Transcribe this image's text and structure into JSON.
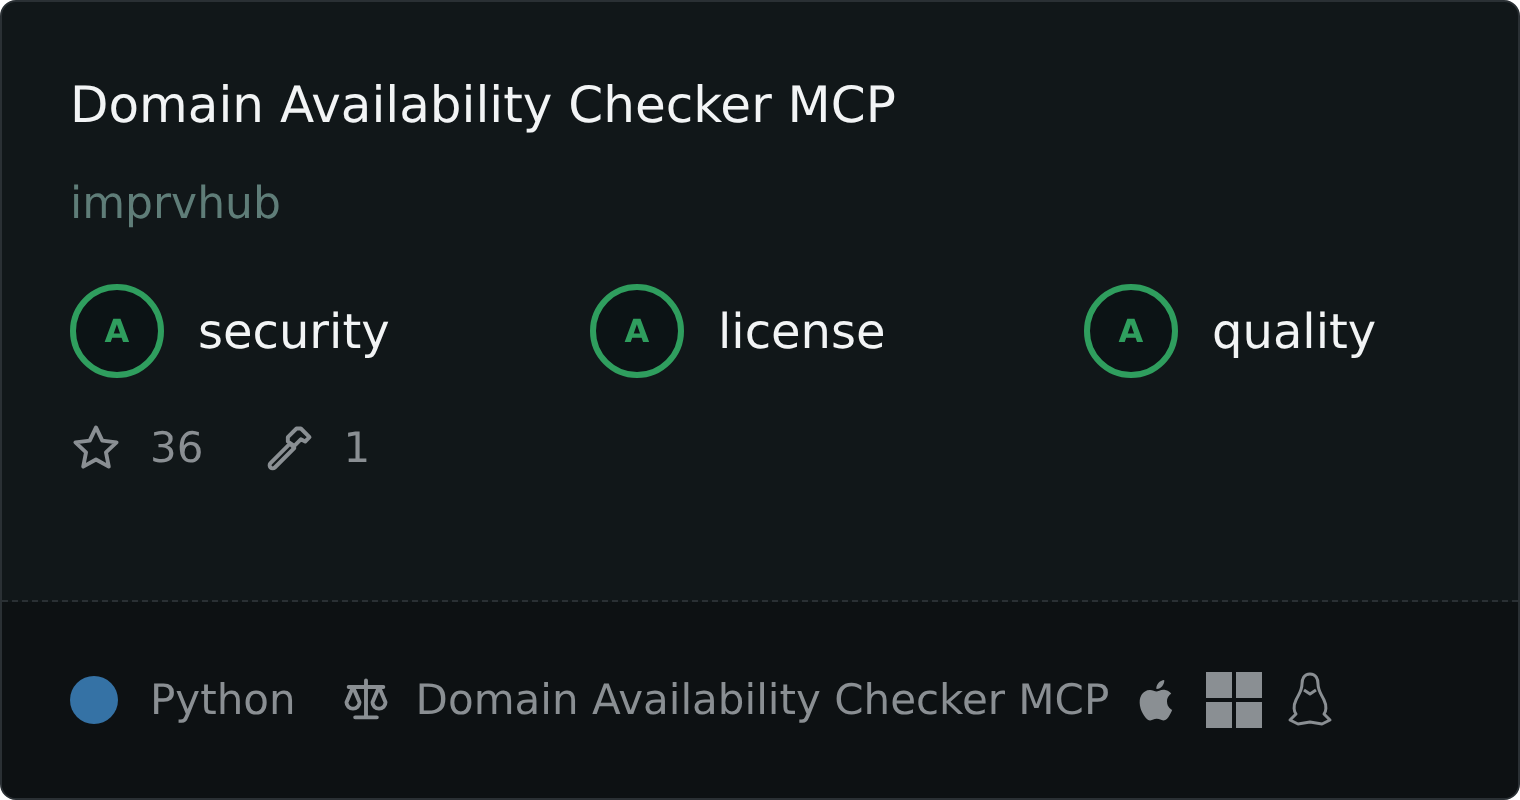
{
  "title": "Domain Availability Checker MCP",
  "author": "imprvhub",
  "scores": [
    {
      "grade": "A",
      "label": "security"
    },
    {
      "grade": "A",
      "label": "license"
    },
    {
      "grade": "A",
      "label": "quality"
    }
  ],
  "stats": {
    "stars": "36",
    "tools": "1"
  },
  "footer": {
    "language": {
      "name": "Python",
      "color": "#3572a5"
    },
    "license": "Domain Availability Checker MCP"
  }
}
